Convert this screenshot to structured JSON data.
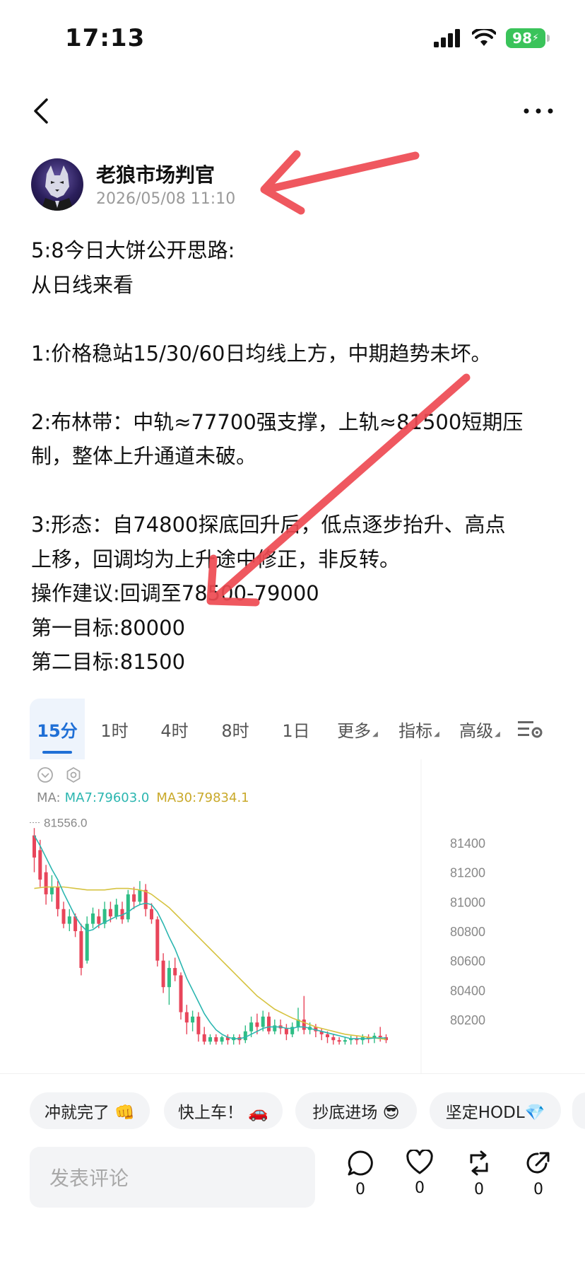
{
  "status": {
    "time": "17:13",
    "battery": "98"
  },
  "author": {
    "name": "老狼市场判官",
    "time": "2026/05/08 11:10"
  },
  "post": {
    "lines": [
      "5:8今日大饼公开思路:",
      "从日线来看",
      "",
      "1:价格稳站15/30/60日均线上方，中期趋势未坏。",
      "",
      "2:布林带：中轨≈77700强支撑，上轨≈81500短期压",
      "制，整体上升通道未破。",
      "",
      "3:形态：自74800探底回升后，低点逐步抬升、高点",
      "上移，回调均为上升途中修正，非反转。",
      "操作建议:回调至78500-79000",
      "第一目标:80000",
      "第二目标:81500"
    ]
  },
  "chart": {
    "tabs": [
      "15分",
      "1时",
      "4时",
      "8时",
      "1日",
      "更多",
      "指标",
      "高级"
    ],
    "active_tab": "15分",
    "ma_label": "MA:",
    "ma7": "MA7:79603.0",
    "ma30": "MA30:79834.1",
    "high_marker": "81556.0",
    "colors": {
      "up": "#2ebd85",
      "down": "#e8455a",
      "ma7": "#2bb6b0",
      "ma30": "#d6c341",
      "accent": "#1f6fd6"
    }
  },
  "chart_data": {
    "type": "candlestick",
    "y_ticks": [
      "81400",
      "81200",
      "81000",
      "80800",
      "80600",
      "80400",
      "80200"
    ],
    "ylim": [
      80030,
      81520
    ],
    "annotation": "81556.0",
    "candles": [
      {
        "o": 81450,
        "c": 81300,
        "h": 81500,
        "l": 81200
      },
      {
        "o": 81350,
        "c": 81150,
        "h": 81420,
        "l": 81100
      },
      {
        "o": 81200,
        "c": 81050,
        "h": 81250,
        "l": 80980
      },
      {
        "o": 81050,
        "c": 81100,
        "h": 81180,
        "l": 81000
      },
      {
        "o": 81100,
        "c": 80950,
        "h": 81140,
        "l": 80900
      },
      {
        "o": 80950,
        "c": 80850,
        "h": 81000,
        "l": 80820
      },
      {
        "o": 80850,
        "c": 80900,
        "h": 80950,
        "l": 80800
      },
      {
        "o": 80900,
        "c": 80800,
        "h": 80920,
        "l": 80760
      },
      {
        "o": 80800,
        "c": 80550,
        "h": 80850,
        "l": 80500
      },
      {
        "o": 80600,
        "c": 80850,
        "h": 80900,
        "l": 80580
      },
      {
        "o": 80850,
        "c": 80920,
        "h": 80960,
        "l": 80820
      },
      {
        "o": 80900,
        "c": 80850,
        "h": 80950,
        "l": 80820
      },
      {
        "o": 80850,
        "c": 80950,
        "h": 81000,
        "l": 80820
      },
      {
        "o": 80950,
        "c": 80900,
        "h": 81000,
        "l": 80860
      },
      {
        "o": 80900,
        "c": 80980,
        "h": 81020,
        "l": 80880
      },
      {
        "o": 80950,
        "c": 80880,
        "h": 81000,
        "l": 80850
      },
      {
        "o": 80880,
        "c": 81050,
        "h": 81080,
        "l": 80860
      },
      {
        "o": 81050,
        "c": 81000,
        "h": 81100,
        "l": 80950
      },
      {
        "o": 81000,
        "c": 81080,
        "h": 81140,
        "l": 80980
      },
      {
        "o": 81080,
        "c": 80950,
        "h": 81120,
        "l": 80900
      },
      {
        "o": 80950,
        "c": 80880,
        "h": 80990,
        "l": 80850
      },
      {
        "o": 80880,
        "c": 80600,
        "h": 80900,
        "l": 80560
      },
      {
        "o": 80600,
        "c": 80420,
        "h": 80650,
        "l": 80380
      },
      {
        "o": 80420,
        "c": 80550,
        "h": 80600,
        "l": 80300
      },
      {
        "o": 80550,
        "c": 80500,
        "h": 80620,
        "l": 80460
      },
      {
        "o": 80500,
        "c": 80250,
        "h": 80520,
        "l": 80200
      },
      {
        "o": 80250,
        "c": 80180,
        "h": 80300,
        "l": 80100
      },
      {
        "o": 80180,
        "c": 80220,
        "h": 80260,
        "l": 80120
      },
      {
        "o": 80220,
        "c": 80100,
        "h": 80250,
        "l": 80050
      },
      {
        "o": 80100,
        "c": 80050,
        "h": 80150,
        "l": 80030
      },
      {
        "o": 80050,
        "c": 80080,
        "h": 80100,
        "l": 80030
      },
      {
        "o": 80080,
        "c": 80050,
        "h": 80100,
        "l": 80030
      },
      {
        "o": 80050,
        "c": 80080,
        "h": 80090,
        "l": 80030
      },
      {
        "o": 80080,
        "c": 80060,
        "h": 80100,
        "l": 80030
      },
      {
        "o": 80060,
        "c": 80080,
        "h": 80100,
        "l": 80030
      },
      {
        "o": 80080,
        "c": 80060,
        "h": 80100,
        "l": 80030
      },
      {
        "o": 80060,
        "c": 80120,
        "h": 80160,
        "l": 80040
      },
      {
        "o": 80120,
        "c": 80180,
        "h": 80220,
        "l": 80080
      },
      {
        "o": 80180,
        "c": 80150,
        "h": 80240,
        "l": 80100
      },
      {
        "o": 80150,
        "c": 80220,
        "h": 80260,
        "l": 80120
      },
      {
        "o": 80220,
        "c": 80120,
        "h": 80250,
        "l": 80100
      },
      {
        "o": 80120,
        "c": 80160,
        "h": 80200,
        "l": 80100
      },
      {
        "o": 80160,
        "c": 80140,
        "h": 80200,
        "l": 80100
      },
      {
        "o": 80140,
        "c": 80100,
        "h": 80170,
        "l": 80060
      },
      {
        "o": 80100,
        "c": 80150,
        "h": 80180,
        "l": 80080
      },
      {
        "o": 80150,
        "c": 80200,
        "h": 80280,
        "l": 80120
      },
      {
        "o": 80200,
        "c": 80130,
        "h": 80360,
        "l": 80100
      },
      {
        "o": 80130,
        "c": 80150,
        "h": 80180,
        "l": 80100
      },
      {
        "o": 80150,
        "c": 80120,
        "h": 80170,
        "l": 80080
      },
      {
        "o": 80120,
        "c": 80100,
        "h": 80140,
        "l": 80060
      },
      {
        "o": 80100,
        "c": 80080,
        "h": 80120,
        "l": 80040
      },
      {
        "o": 80080,
        "c": 80060,
        "h": 80100,
        "l": 80030
      },
      {
        "o": 80060,
        "c": 80050,
        "h": 80080,
        "l": 80030
      },
      {
        "o": 80050,
        "c": 80060,
        "h": 80080,
        "l": 80030
      },
      {
        "o": 80060,
        "c": 80070,
        "h": 80090,
        "l": 80030
      },
      {
        "o": 80070,
        "c": 80060,
        "h": 80090,
        "l": 80030
      },
      {
        "o": 80060,
        "c": 80080,
        "h": 80100,
        "l": 80030
      },
      {
        "o": 80080,
        "c": 80070,
        "h": 80100,
        "l": 80040
      },
      {
        "o": 80070,
        "c": 80090,
        "h": 80110,
        "l": 80040
      },
      {
        "o": 80090,
        "c": 80080,
        "h": 80150,
        "l": 80050
      },
      {
        "o": 80080,
        "c": 80060,
        "h": 80100,
        "l": 80040
      }
    ],
    "ma7": [
      81450,
      81380,
      81300,
      81220,
      81150,
      81060,
      80980,
      80900,
      80840,
      80800,
      80810,
      80840,
      80860,
      80880,
      80900,
      80910,
      80930,
      80960,
      80980,
      80990,
      80980,
      80930,
      80850,
      80760,
      80680,
      80580,
      80480,
      80400,
      80320,
      80240,
      80180,
      80130,
      80100,
      80080,
      80070,
      80070,
      80080,
      80100,
      80120,
      80140,
      80150,
      80150,
      80150,
      80140,
      80140,
      80150,
      80150,
      80140,
      80130,
      80120,
      80110,
      80100,
      80090,
      80080,
      80070,
      80070,
      80070,
      80070,
      80075,
      80075,
      80075
    ],
    "ma30": [
      81090,
      81095,
      81100,
      81100,
      81100,
      81100,
      81095,
      81090,
      81085,
      81080,
      81080,
      81080,
      81080,
      81085,
      81090,
      81090,
      81090,
      81085,
      81080,
      81070,
      81050,
      81020,
      80990,
      80960,
      80920,
      80880,
      80840,
      80800,
      80760,
      80720,
      80680,
      80640,
      80600,
      80560,
      80520,
      80480,
      80440,
      80400,
      80360,
      80330,
      80300,
      80270,
      80250,
      80230,
      80210,
      80195,
      80180,
      80165,
      80150,
      80140,
      80130,
      80120,
      80110,
      80100,
      80095,
      80090,
      80085,
      80080,
      80075,
      80070,
      80065
    ]
  },
  "reactions": [
    "冲就完了 👊",
    "快上车！ 🚗",
    "抄底进场 😎",
    "坚定HODL💎"
  ],
  "comment": {
    "placeholder": "发表评论",
    "counts": {
      "comment": "0",
      "like": "0",
      "repost": "0",
      "share": "0"
    }
  }
}
